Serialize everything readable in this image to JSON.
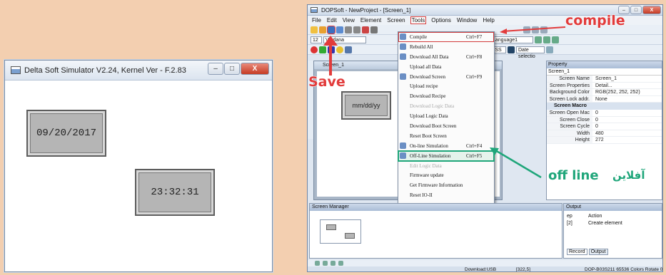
{
  "simulator": {
    "title": "Delta Soft Simulator V2.24, Kernel Ver - F.2.83",
    "date_value": "09/20/2017",
    "time_value": "23:32:31",
    "min_glyph": "–",
    "max_glyph": "□",
    "close_glyph": "X"
  },
  "dopsoft": {
    "title": "DOPSoft - NewProject - [Screen_1]",
    "menu": [
      "File",
      "Edit",
      "View",
      "Element",
      "Screen",
      "Tools",
      "Options",
      "Window",
      "Help"
    ],
    "toolbar": {
      "font_size": "12",
      "font_name": "Verdana",
      "language": "Language1",
      "date_select": "Date selectio",
      "time_format": "hh:MM:SS"
    },
    "screen_tab": "Screen_1",
    "canvas_element": "mm/dd/yy",
    "tools_menu": [
      {
        "label": "Compile",
        "shortcut": "Ctrl+F7",
        "disabled": false
      },
      {
        "label": "Rebuild All",
        "shortcut": "",
        "disabled": false
      },
      {
        "label": "Download All Data",
        "shortcut": "Ctrl+F8",
        "disabled": false
      },
      {
        "label": "Upload all Data",
        "shortcut": "",
        "disabled": false
      },
      {
        "label": "Download Screen",
        "shortcut": "Ctrl+F9",
        "disabled": false
      },
      {
        "label": "Upload recipe",
        "shortcut": "",
        "disabled": false
      },
      {
        "label": "Download Recipe",
        "shortcut": "",
        "disabled": false
      },
      {
        "label": "Download Logic Data",
        "shortcut": "",
        "disabled": true
      },
      {
        "label": "Upload Logic Data",
        "shortcut": "",
        "disabled": false
      },
      {
        "label": "Download Boot Screen",
        "shortcut": "",
        "disabled": false
      },
      {
        "label": "Reset Boot Screen",
        "shortcut": "",
        "disabled": false
      },
      {
        "label": "On-line Simulation",
        "shortcut": "Ctrl+F4",
        "disabled": false
      },
      {
        "label": "Off-Line Simulation",
        "shortcut": "Ctrl+F5",
        "disabled": false
      },
      {
        "label": "Edit Logic Data",
        "shortcut": "",
        "disabled": true
      },
      {
        "label": "Firmware update",
        "shortcut": "",
        "disabled": false
      },
      {
        "label": "Get Firmware Information",
        "shortcut": "",
        "disabled": false
      },
      {
        "label": "Reset IO-II",
        "shortcut": "",
        "disabled": false
      }
    ],
    "property": {
      "header": "Property",
      "selected": "Screen_1",
      "rows": [
        {
          "k": "Screen Name",
          "v": "Screen_1"
        },
        {
          "k": "Screen Properties",
          "v": "Detail..."
        },
        {
          "k": "Background Color",
          "v": "RGB(252, 252, 252)"
        },
        {
          "k": "Screen Lock addr.",
          "v": "None"
        }
      ],
      "group": "Screen Macro",
      "rows2": [
        {
          "k": "Screen Open Mac",
          "v": "0"
        },
        {
          "k": "Screen Close Macro",
          "v": "0"
        },
        {
          "k": "Screen Cycle Macro",
          "v": "0"
        },
        {
          "k": "Width",
          "v": "480"
        },
        {
          "k": "Height",
          "v": "272"
        }
      ]
    },
    "screen_manager": "Screen Manager",
    "output": {
      "header": "Output",
      "col1": "ep",
      "col2": "Action",
      "row1_a": "[2]",
      "row1_b": "Create element",
      "tab1": "Record",
      "tab2": "Output"
    },
    "status": {
      "download": "Download:USB",
      "coords": "[322,5]",
      "model": "DOP-B03S211 65536 Colors Rotate 0 ("
    }
  },
  "annotations": {
    "compile": "compile",
    "save": "Save",
    "offline": "off line",
    "offline_fa": "آفلاین",
    "color_red": "#e23b3b",
    "color_green": "#1fa67a"
  }
}
